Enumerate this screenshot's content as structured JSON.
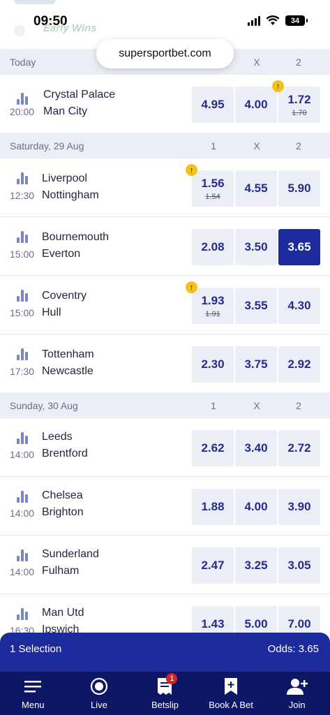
{
  "status_bar": {
    "time": "09:50",
    "battery": "34",
    "promo_text": "Early Wins"
  },
  "browser": {
    "url": "supersportbet.com"
  },
  "sections": [
    {
      "label": "Today",
      "col_1": "",
      "col_x": "X",
      "col_2": "2"
    },
    {
      "label": "Saturday, 29 Aug",
      "col_1": "1",
      "col_x": "X",
      "col_2": "2"
    },
    {
      "label": "Sunday, 30 Aug",
      "col_1": "1",
      "col_x": "X",
      "col_2": "2"
    }
  ],
  "matches": [
    {
      "home": "Crystal Palace",
      "away": "Man City",
      "time": "20:00",
      "odds": [
        {
          "value": "4.95"
        },
        {
          "value": "4.00"
        },
        {
          "value": "1.72",
          "prev": "1.70",
          "badge": "↑"
        }
      ]
    },
    {
      "home": "Liverpool",
      "away": "Nottingham",
      "time": "12:30",
      "odds": [
        {
          "value": "1.56",
          "prev": "1.54",
          "badge": "↑"
        },
        {
          "value": "4.55"
        },
        {
          "value": "5.90"
        }
      ]
    },
    {
      "home": "Bournemouth",
      "away": "Everton",
      "time": "15:00",
      "odds": [
        {
          "value": "2.08"
        },
        {
          "value": "3.50"
        },
        {
          "value": "3.65",
          "selected": true
        }
      ]
    },
    {
      "home": "Coventry",
      "away": "Hull",
      "time": "15:00",
      "odds": [
        {
          "value": "1.93",
          "prev": "1.91",
          "badge": "↑"
        },
        {
          "value": "3.55"
        },
        {
          "value": "4.30"
        }
      ]
    },
    {
      "home": "Tottenham",
      "away": "Newcastle",
      "time": "17:30",
      "odds": [
        {
          "value": "2.30"
        },
        {
          "value": "3.75"
        },
        {
          "value": "2.92"
        }
      ]
    },
    {
      "home": "Leeds",
      "away": "Brentford",
      "time": "14:00",
      "odds": [
        {
          "value": "2.62"
        },
        {
          "value": "3.40"
        },
        {
          "value": "2.72"
        }
      ]
    },
    {
      "home": "Chelsea",
      "away": "Brighton",
      "time": "14:00",
      "odds": [
        {
          "value": "1.88"
        },
        {
          "value": "4.00"
        },
        {
          "value": "3.90"
        }
      ]
    },
    {
      "home": "Sunderland",
      "away": "Fulham",
      "time": "14:00",
      "odds": [
        {
          "value": "2.47"
        },
        {
          "value": "3.25"
        },
        {
          "value": "3.05"
        }
      ]
    },
    {
      "home": "Man Utd",
      "away": "Ipswich",
      "time": "16:30",
      "odds": [
        {
          "value": "1.43"
        },
        {
          "value": "5.00"
        },
        {
          "value": "7.00"
        }
      ]
    }
  ],
  "selection_bar": {
    "selection_text": "1 Selection",
    "odds_text": "Odds: 3.65"
  },
  "bottom_nav": {
    "items": [
      {
        "label": "Menu",
        "icon": "menu-icon"
      },
      {
        "label": "Live",
        "icon": "live-icon"
      },
      {
        "label": "Betslip",
        "icon": "betslip-icon",
        "badge": "1"
      },
      {
        "label": "Book A Bet",
        "icon": "book-a-bet-icon"
      },
      {
        "label": "Join",
        "icon": "join-icon"
      }
    ]
  },
  "colors": {
    "accent": "#1c2a9c",
    "nav_bg": "#0e1766",
    "odds_bg": "#eceef6",
    "badge_yellow": "#f1c21b",
    "badge_red": "#d42424"
  }
}
